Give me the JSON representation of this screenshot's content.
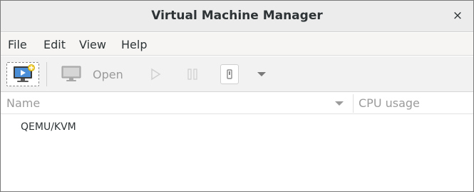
{
  "window": {
    "title": "Virtual Machine Manager",
    "close_glyph": "×"
  },
  "menubar": {
    "items": [
      {
        "label": "File"
      },
      {
        "label": "Edit"
      },
      {
        "label": "View"
      },
      {
        "label": "Help"
      }
    ]
  },
  "toolbar": {
    "new_vm_icon": "monitor-new-icon",
    "open_icon": "monitor-icon",
    "open_label": "Open",
    "run_icon": "play-icon",
    "pause_icon": "pause-icon",
    "shutdown_icon": "power-icon",
    "menu_icon": "chevron-down-icon"
  },
  "columns": {
    "name": "Name",
    "cpu": "CPU usage"
  },
  "connections": [
    {
      "label": "QEMU/KVM"
    }
  ]
}
